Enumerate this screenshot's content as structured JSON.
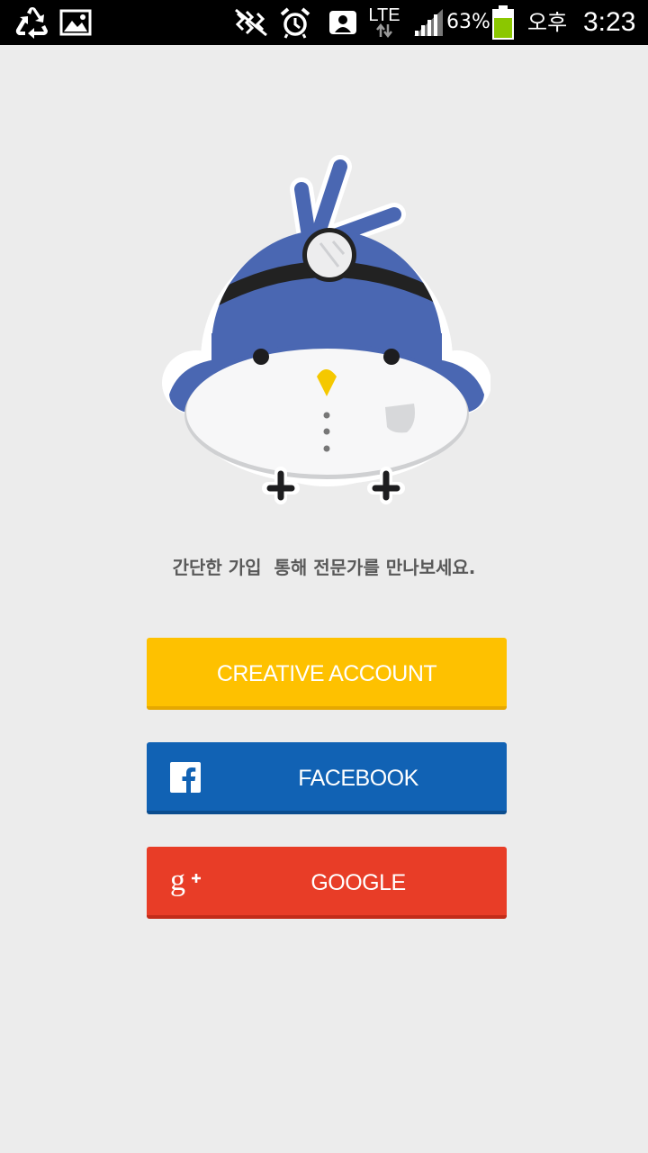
{
  "status_bar": {
    "icons": [
      "recycle-icon",
      "image-icon",
      "mute-icon",
      "alarm-icon",
      "contact-icon",
      "signal-icon",
      "battery-icon"
    ],
    "network": "LTE",
    "battery": "63%",
    "battery_level": 0.63,
    "ampm": "오후",
    "time": "3:23"
  },
  "mascot": {
    "icon": "doctor-bird-mascot",
    "colors": {
      "body": "#4a67b2",
      "belly": "#f7f7f7",
      "beak": "#f5c800",
      "band": "#222222"
    }
  },
  "tagline": "간단한 가입  통해 전문가를 만나보세요.",
  "buttons": {
    "creative": {
      "label": "CREATIVE ACCOUNT",
      "color": "#fec100"
    },
    "facebook": {
      "label": "FACEBOOK",
      "color": "#1162b4",
      "icon": "facebook-icon"
    },
    "google": {
      "label": "GOOGLE",
      "color": "#e83d27",
      "icon": "google-plus-icon"
    }
  }
}
